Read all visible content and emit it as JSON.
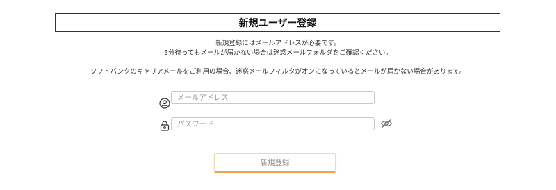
{
  "page_title": "新規ユーザー登録",
  "notice": {
    "line1": "新規登録にはメールアドレスが必要です。",
    "line2": "3分待ってもメールが届かない場合は迷惑メールフォルダをご確認ください。",
    "line3": "ソフトバンクのキャリアメールをご利用の場合、迷惑メールフィルタがオンになっているとメールが届かない場合があります。"
  },
  "form": {
    "email": {
      "placeholder": "メールアドレス",
      "value": "",
      "icon": "user-icon"
    },
    "password": {
      "placeholder": "パスワード",
      "value": "",
      "icon": "lock-icon",
      "toggle_icon": "eye-off-icon"
    },
    "submit_label": "新規登録"
  },
  "colors": {
    "accent": "#f0a24a",
    "border": "#c8c8c8",
    "text": "#333333"
  }
}
